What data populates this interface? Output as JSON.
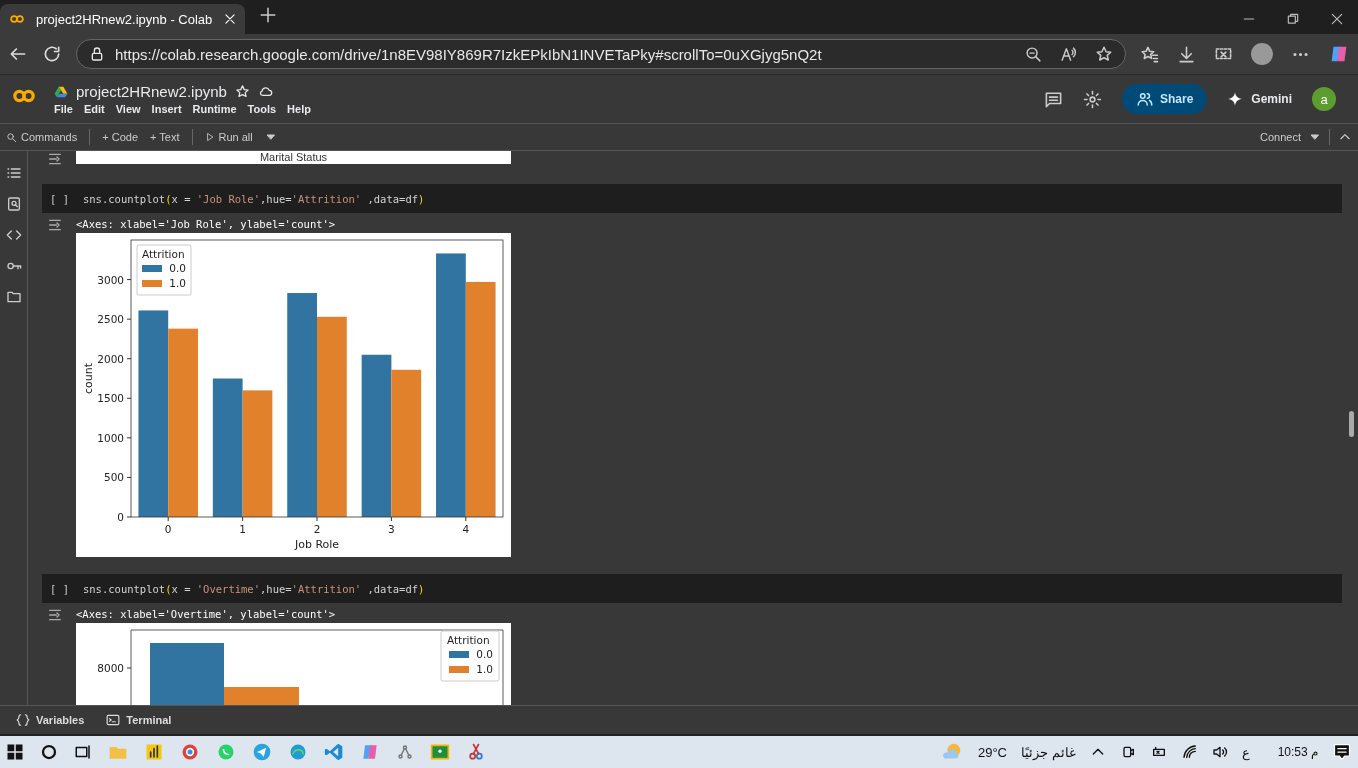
{
  "browser": {
    "tabs": [
      {
        "title": "project2HRnew2.ipynb - Colab",
        "selected": true
      }
    ],
    "url": "https://colab.research.google.com/drive/1n8EV98IY869R7IzkEPkIbN1INVETaPky#scrollTo=0uXGjyg5nQ2t"
  },
  "colab": {
    "notebook_title": "project2HRnew2.ipynb",
    "menu": [
      "File",
      "Edit",
      "View",
      "Insert",
      "Runtime",
      "Tools",
      "Help"
    ],
    "share": "Share",
    "gemini": "Gemini",
    "avatar": "a"
  },
  "toolbar": {
    "commands": "Commands",
    "add_code": "+ Code",
    "add_text": "+ Text",
    "run_all": "Run all",
    "connect": "Connect"
  },
  "cells": [
    {
      "kind": "output_tail",
      "caption": "Marital Status"
    },
    {
      "kind": "code",
      "prompt": "[ ]",
      "code": [
        {
          "kind": "plain",
          "text": "sns.countplot"
        },
        {
          "kind": "paren",
          "text": "("
        },
        {
          "kind": "plain",
          "text": "x = "
        },
        {
          "kind": "string",
          "text": "'Job Role'"
        },
        {
          "kind": "plain",
          "text": ",hue="
        },
        {
          "kind": "string",
          "text": "'Attrition'"
        },
        {
          "kind": "plain",
          "text": " ,data=df"
        },
        {
          "kind": "paren",
          "text": ")"
        }
      ],
      "output_text": "<Axes: xlabel='Job Role', ylabel='count'>",
      "chart_data": {
        "type": "bar",
        "xlabel": "Job Role",
        "ylabel": "count",
        "categories": [
          "0",
          "1",
          "2",
          "3",
          "4"
        ],
        "legend": {
          "title": "Attrition"
        },
        "series": [
          {
            "name": "0.0",
            "color": "#3274a1",
            "values": [
              2610,
              1750,
              2830,
              2050,
              3330
            ]
          },
          {
            "name": "1.0",
            "color": "#e1812c",
            "values": [
              2380,
              1600,
              2530,
              1860,
              2970
            ]
          }
        ],
        "ylim": [
          0,
          3500
        ],
        "yticks": [
          0,
          500,
          1000,
          1500,
          2000,
          2500,
          3000
        ]
      }
    },
    {
      "kind": "code",
      "prompt": "[ ]",
      "code": [
        {
          "kind": "plain",
          "text": "sns.countplot"
        },
        {
          "kind": "paren",
          "text": "("
        },
        {
          "kind": "plain",
          "text": "x = "
        },
        {
          "kind": "string",
          "text": "'Overtime'"
        },
        {
          "kind": "plain",
          "text": ",hue="
        },
        {
          "kind": "string",
          "text": "'Attrition'"
        },
        {
          "kind": "plain",
          "text": " ,data=df"
        },
        {
          "kind": "paren",
          "text": ")"
        }
      ],
      "output_text": "<Axes: xlabel='Overtime', ylabel='count'>",
      "plot_preview": {
        "ytick": "8000",
        "legend_title": "Attrition",
        "legend": [
          {
            "name": "0.0",
            "color": "#3274a1"
          },
          {
            "name": "1.0",
            "color": "#e1812c"
          }
        ]
      }
    }
  ],
  "bottom_bar": [
    "Variables",
    "Terminal"
  ],
  "taskbar": {
    "weather_temp": "29°C",
    "weather_text": "غائم جزئيًا",
    "language": "ع",
    "time": "10:53 م"
  }
}
